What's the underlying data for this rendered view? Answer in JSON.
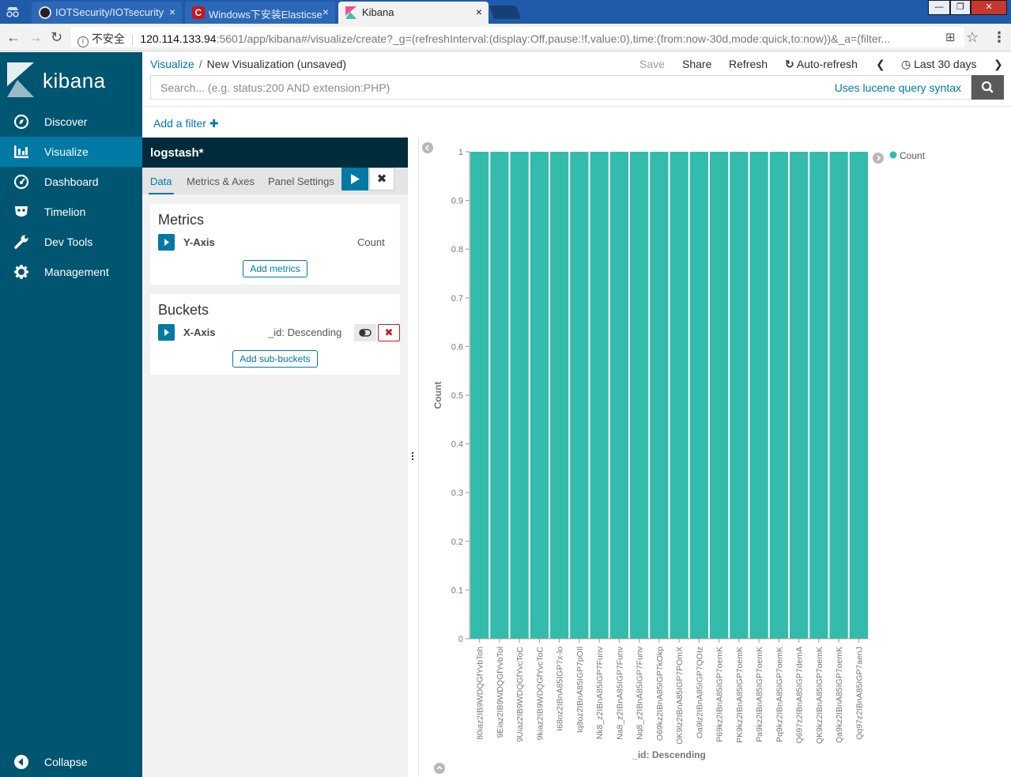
{
  "browser": {
    "tabs": [
      {
        "title": "IOTSecurity/IOTsecurity",
        "close": "×"
      },
      {
        "title": "Windows下安装Elasticse",
        "close": "×"
      },
      {
        "title": "Kibana",
        "close": "×"
      }
    ],
    "address": {
      "security_label": "不安全",
      "host": "120.114.133.94",
      "rest": ":5601/app/kibana#/visualize/create?_g=(refreshInterval:(display:Off,pause:!f,value:0),time:(from:now-30d,mode:quick,to:now))&_a=(filter..."
    }
  },
  "sidebar": {
    "logo_text": "kibana",
    "items": [
      {
        "label": "Discover",
        "icon": "compass-icon"
      },
      {
        "label": "Visualize",
        "icon": "bar-chart-icon"
      },
      {
        "label": "Dashboard",
        "icon": "dashboard-gauge-icon"
      },
      {
        "label": "Timelion",
        "icon": "timelion-mask-icon"
      },
      {
        "label": "Dev Tools",
        "icon": "wrench-icon"
      },
      {
        "label": "Management",
        "icon": "gear-icon"
      }
    ],
    "active": "Visualize",
    "collapse_label": "Collapse"
  },
  "topbar": {
    "breadcrumb_root": "Visualize",
    "breadcrumb_sep": "/",
    "breadcrumb_current": "New Visualization (unsaved)",
    "save": "Save",
    "share": "Share",
    "refresh": "Refresh",
    "auto_refresh": "Auto-refresh",
    "time_range": "Last 30 days",
    "search_placeholder": "Search... (e.g. status:200 AND extension:PHP)",
    "lucene_link": "Uses lucene query syntax",
    "add_filter": "Add a filter"
  },
  "editor": {
    "index_pattern": "logstash*",
    "tabs": [
      "Data",
      "Metrics & Axes",
      "Panel Settings"
    ],
    "active_tab": "Data",
    "discard_symbol": "✖",
    "metrics": {
      "title": "Metrics",
      "row_label": "Y-Axis",
      "row_value": "Count",
      "add_button": "Add metrics"
    },
    "buckets": {
      "title": "Buckets",
      "row_label": "X-Axis",
      "row_value": "_id: Descending",
      "remove_symbol": "✖",
      "add_button": "Add sub-buckets"
    }
  },
  "colors": {
    "sidebar": "#005571",
    "sidebar_active": "#0079a5",
    "link": "#0079a5",
    "bar": "#33bbab",
    "index_header": "#002b3b"
  },
  "chart_data": {
    "type": "bar",
    "xlabel": "_id: Descending",
    "ylabel": "Count",
    "ylim": [
      0,
      1
    ],
    "yticks": [
      0,
      0.1,
      0.2,
      0.3,
      0.4,
      0.5,
      0.6,
      0.7,
      0.8,
      0.9,
      1
    ],
    "grid": false,
    "legend_position": "top-right",
    "categories": [
      "80iaz2IB9WDQGfYvbToh",
      "9Eiaz2IB9WDQGfYvbTol",
      "9Uiaz2IB9WDQGfYvcToC",
      "9kiaz2IB9WDQGfYvcToC",
      "I68oz2IBnA85IGP7x-lo",
      "Iq8oz2IBnA85IGP7pOIl",
      "Nk8_z2IBnA85IGP7Funv",
      "Na8_z2IBnA85IGP7Funv",
      "Nq8_z2IBnA85IGP7Funv",
      "O69kz2IBnA85IGP7kOkp",
      "OK9lz2IBnA85IGP7POmX",
      "Oa9lz2IBnA85IGP7QOIz",
      "P69kz2IBnA85IGP7oemK",
      "PK9kz2IBnA85IGP7oemK",
      "Pa9kz2IBnA85IGP7oemK",
      "Pq9kz2IBnA85IGP7oemK",
      "Q697z2IBnA85IGP7demA",
      "QK9kz2IBnA85IGP7oemK",
      "Qa9kz2IBnA85IGP7oemK",
      "Qq97z2IBnA85IGP7aenJ"
    ],
    "series": [
      {
        "name": "Count",
        "color": "#33bbab",
        "values": [
          1,
          1,
          1,
          1,
          1,
          1,
          1,
          1,
          1,
          1,
          1,
          1,
          1,
          1,
          1,
          1,
          1,
          1,
          1,
          1
        ]
      }
    ]
  }
}
